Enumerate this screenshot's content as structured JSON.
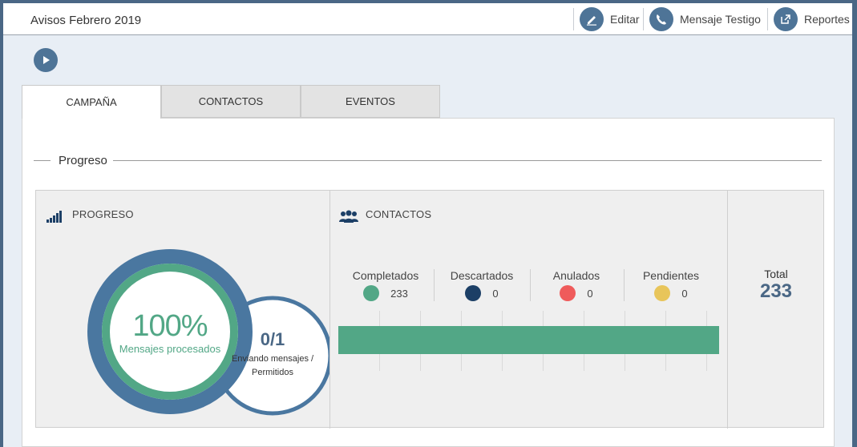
{
  "header": {
    "title": "Avisos Febrero 2019",
    "buttons": [
      {
        "label": "Editar",
        "icon": "pencil-icon"
      },
      {
        "label": "Mensaje Testigo",
        "icon": "phone-icon"
      },
      {
        "label": "Reportes",
        "icon": "external-link-icon"
      }
    ]
  },
  "play_icon": "play-icon",
  "tabs": [
    {
      "label": "CAMPAÑA",
      "active": true
    },
    {
      "label": "CONTACTOS",
      "active": false
    },
    {
      "label": "EVENTOS",
      "active": false
    }
  ],
  "section_legend": "Progreso",
  "progress": {
    "title": "PROGRESO",
    "icon": "signal-bars-icon",
    "percent": "100%",
    "percent_label": "Mensajes procesados",
    "percent_value": 1.0,
    "sending": "0/1",
    "sending_label_1": "Enviando mensajes /",
    "sending_label_2": "Permitidos"
  },
  "contacts": {
    "title": "CONTACTOS",
    "icon": "users-icon",
    "items": [
      {
        "label": "Completados",
        "value": "233",
        "color": "#52a786"
      },
      {
        "label": "Descartados",
        "value": "0",
        "color": "#1c3f66"
      },
      {
        "label": "Anulados",
        "value": "0",
        "color": "#ef5b5b"
      },
      {
        "label": "Pendientes",
        "value": "0",
        "color": "#e8c55a"
      }
    ],
    "bar_fraction": 1.0
  },
  "total": {
    "label": "Total",
    "value": "233"
  },
  "colors": {
    "accent": "#4e7497",
    "ring_outer": "#4a77a0",
    "ring_inner": "#52a786"
  }
}
